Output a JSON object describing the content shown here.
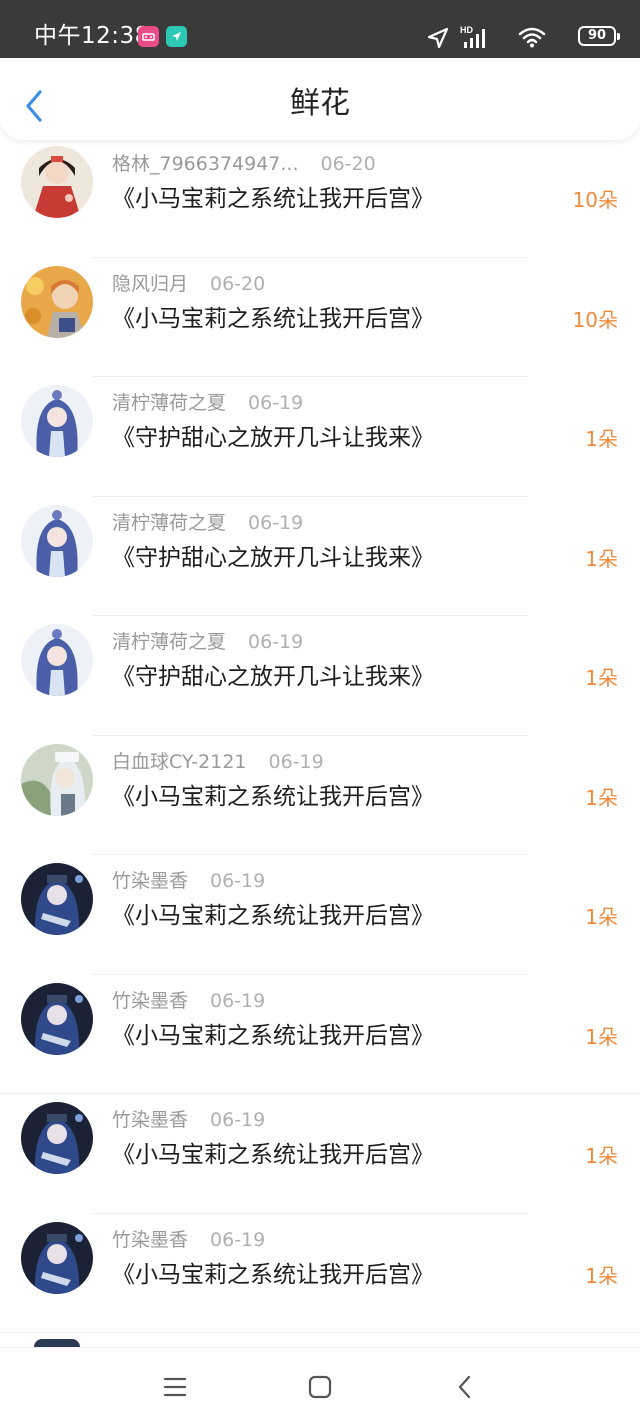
{
  "status_bar": {
    "time": "中午12:38",
    "battery": "90",
    "icons": [
      "app-notification-icon",
      "location-share-icon",
      "location-arrow-icon",
      "hd-signal-icon",
      "wifi-icon",
      "battery-icon"
    ]
  },
  "header": {
    "title": "鲜花",
    "back_icon": "chevron-left-icon"
  },
  "rows": [
    {
      "user": "格林_7966374947...",
      "date": "06-20",
      "book": "《小马宝莉之系统让我开后宫》",
      "count": "10朵",
      "avatar": "avatar-red-dress"
    },
    {
      "user": "隐风归月",
      "date": "06-20",
      "book": "《小马宝莉之系统让我开后宫》",
      "count": "10朵",
      "avatar": "avatar-orange-hair"
    },
    {
      "user": "清柠薄荷之夏",
      "date": "06-19",
      "book": "《守护甜心之放开几斗让我来》",
      "count": "1朵",
      "avatar": "avatar-blue-hair"
    },
    {
      "user": "清柠薄荷之夏",
      "date": "06-19",
      "book": "《守护甜心之放开几斗让我来》",
      "count": "1朵",
      "avatar": "avatar-blue-hair"
    },
    {
      "user": "清柠薄荷之夏",
      "date": "06-19",
      "book": "《守护甜心之放开几斗让我来》",
      "count": "1朵",
      "avatar": "avatar-blue-hair"
    },
    {
      "user": "白血球CY-2121",
      "date": "06-19",
      "book": "《小马宝莉之系统让我开后宫》",
      "count": "1朵",
      "avatar": "avatar-white-hair"
    },
    {
      "user": "竹染墨香",
      "date": "06-19",
      "book": "《小马宝莉之系统让我开后宫》",
      "count": "1朵",
      "avatar": "avatar-dark-blue"
    },
    {
      "user": "竹染墨香",
      "date": "06-19",
      "book": "《小马宝莉之系统让我开后宫》",
      "count": "1朵",
      "avatar": "avatar-dark-blue"
    },
    {
      "user": "竹染墨香",
      "date": "06-19",
      "book": "《小马宝莉之系统让我开后宫》",
      "count": "1朵",
      "avatar": "avatar-dark-blue"
    },
    {
      "user": "竹染墨香",
      "date": "06-19",
      "book": "《小马宝莉之系统让我开后宫》",
      "count": "1朵",
      "avatar": "avatar-dark-blue"
    }
  ],
  "colors": {
    "accent_blue": "#3a8ee6",
    "count_orange": "#f08a3a",
    "status_bar": "#3a3a3a"
  },
  "nav_bar": {
    "icons": [
      "menu-icon",
      "home-square-icon",
      "back-chevron-icon"
    ]
  }
}
